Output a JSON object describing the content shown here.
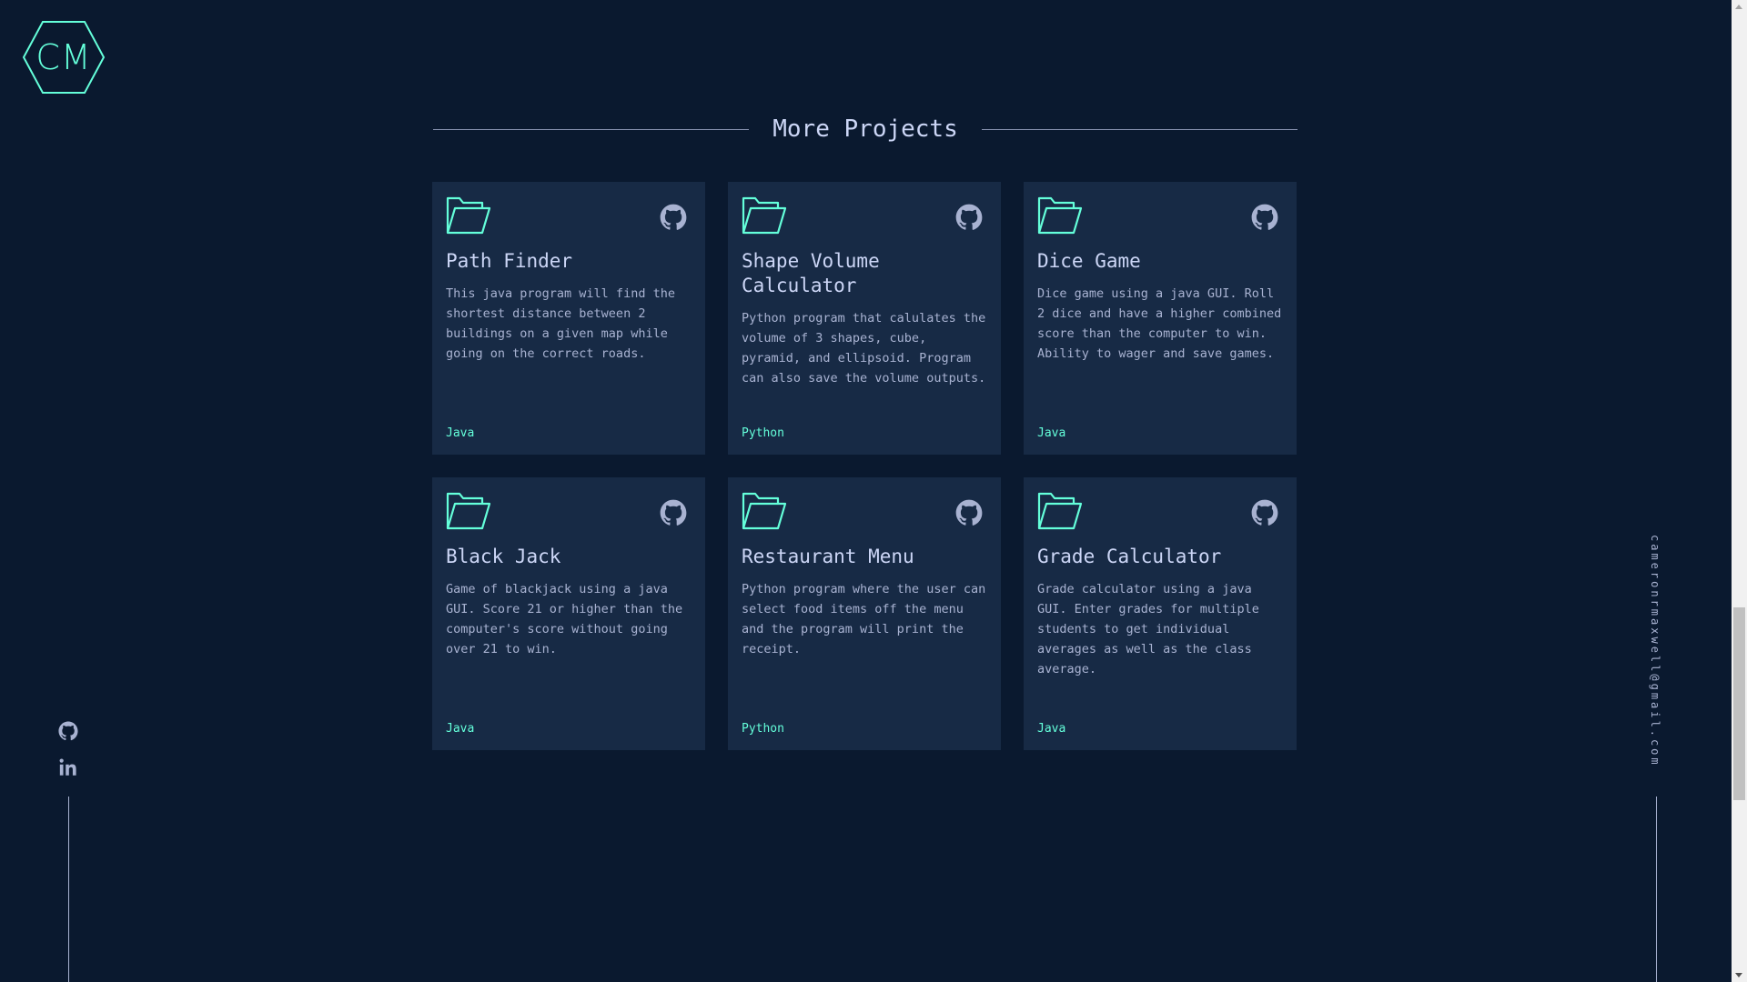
{
  "logo": {
    "text": "CM",
    "color": "#64ffda"
  },
  "section": {
    "title": "More Projects"
  },
  "projects": [
    {
      "title": "Path Finder",
      "description": "This java program will find the shortest distance between 2 buildings on a given map while going on the correct roads.",
      "tech": "Java"
    },
    {
      "title": "Shape Volume Calculator",
      "description": "Python program that calulates the volume of 3 shapes, cube, pyramid, and ellipsoid. Program can also save the volume outputs.",
      "tech": "Python"
    },
    {
      "title": "Dice Game",
      "description": "Dice game using a java GUI. Roll 2 dice and have a higher combined score than the computer to win. Ability to wager and save games.",
      "tech": "Java"
    },
    {
      "title": "Black Jack",
      "description": "Game of blackjack using a java GUI. Score 21 or higher than the computer's score without going over 21 to win.",
      "tech": "Java"
    },
    {
      "title": "Restaurant Menu",
      "description": "Python program where the user can select food items off the menu and the program will print the receipt.",
      "tech": "Python"
    },
    {
      "title": "Grade Calculator",
      "description": "Grade calculator using a java GUI. Enter grades for multiple students to get individual averages as well as the class average.",
      "tech": "Java"
    }
  ],
  "icons": {
    "folder": "folder-icon",
    "repo": "github-icon",
    "social": [
      "github-icon",
      "linkedin-icon"
    ]
  },
  "email": "cameronrmaxwell@gmail.com",
  "colors": {
    "background": "#0a192f",
    "card": "#172a45",
    "accent": "#64ffda",
    "heading": "#ccd6f6",
    "text": "#a8b2d1"
  }
}
